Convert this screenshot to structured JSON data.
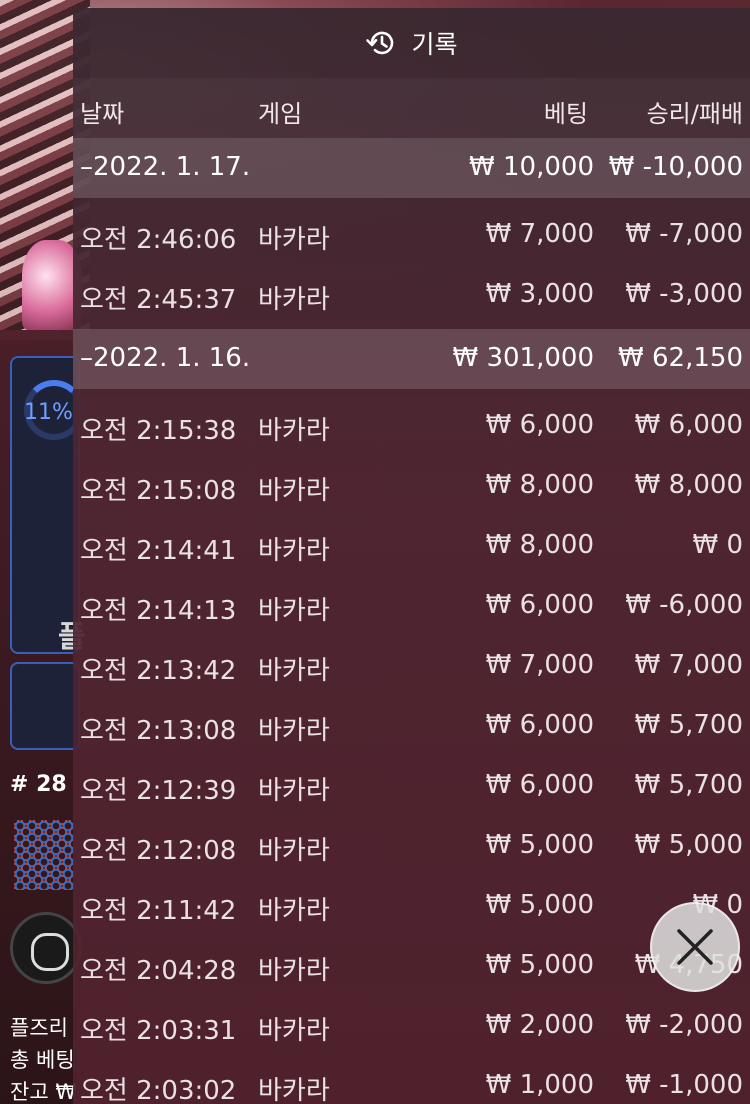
{
  "background": {
    "side_percent": "11%",
    "side_letter": "플",
    "round": "# 28",
    "footer_lines": [
      "플즈리",
      "총 베팅",
      "잔고 ₩"
    ]
  },
  "history": {
    "title": "기록",
    "columns": {
      "date": "날짜",
      "game": "게임",
      "bet": "베팅",
      "win_loss": "승리/패배"
    },
    "groups": [
      {
        "date": "–2022. 1. 17.",
        "bet_total": "₩ 10,000",
        "win_total": "₩ -10,000",
        "rows": [
          {
            "time": "오전 2:46:06",
            "game": "바카라",
            "bet": "₩ 7,000",
            "win": "₩ -7,000"
          },
          {
            "time": "오전 2:45:37",
            "game": "바카라",
            "bet": "₩ 3,000",
            "win": "₩ -3,000"
          }
        ]
      },
      {
        "date": "–2022. 1. 16.",
        "bet_total": "₩ 301,000",
        "win_total": "₩ 62,150",
        "rows": [
          {
            "time": "오전 2:15:38",
            "game": "바카라",
            "bet": "₩ 6,000",
            "win": "₩ 6,000"
          },
          {
            "time": "오전 2:15:08",
            "game": "바카라",
            "bet": "₩ 8,000",
            "win": "₩ 8,000"
          },
          {
            "time": "오전 2:14:41",
            "game": "바카라",
            "bet": "₩ 8,000",
            "win": "₩ 0"
          },
          {
            "time": "오전 2:14:13",
            "game": "바카라",
            "bet": "₩ 6,000",
            "win": "₩ -6,000"
          },
          {
            "time": "오전 2:13:42",
            "game": "바카라",
            "bet": "₩ 7,000",
            "win": "₩ 7,000"
          },
          {
            "time": "오전 2:13:08",
            "game": "바카라",
            "bet": "₩ 6,000",
            "win": "₩ 5,700"
          },
          {
            "time": "오전 2:12:39",
            "game": "바카라",
            "bet": "₩ 6,000",
            "win": "₩ 5,700"
          },
          {
            "time": "오전 2:12:08",
            "game": "바카라",
            "bet": "₩ 5,000",
            "win": "₩ 5,000"
          },
          {
            "time": "오전 2:11:42",
            "game": "바카라",
            "bet": "₩ 5,000",
            "win": "₩ 0"
          },
          {
            "time": "오전 2:04:28",
            "game": "바카라",
            "bet": "₩ 5,000",
            "win": "₩ 4,750"
          },
          {
            "time": "오전 2:03:31",
            "game": "바카라",
            "bet": "₩ 2,000",
            "win": "₩ -2,000"
          },
          {
            "time": "오전 2:03:02",
            "game": "바카라",
            "bet": "₩ 1,000",
            "win": "₩ -1,000"
          }
        ]
      }
    ]
  },
  "colors": {
    "overlay": "#4e2632",
    "group_row": "#6a4a52",
    "accent_blue": "#4a7df0"
  },
  "icons": {
    "history": "history-icon",
    "close": "close-icon"
  }
}
